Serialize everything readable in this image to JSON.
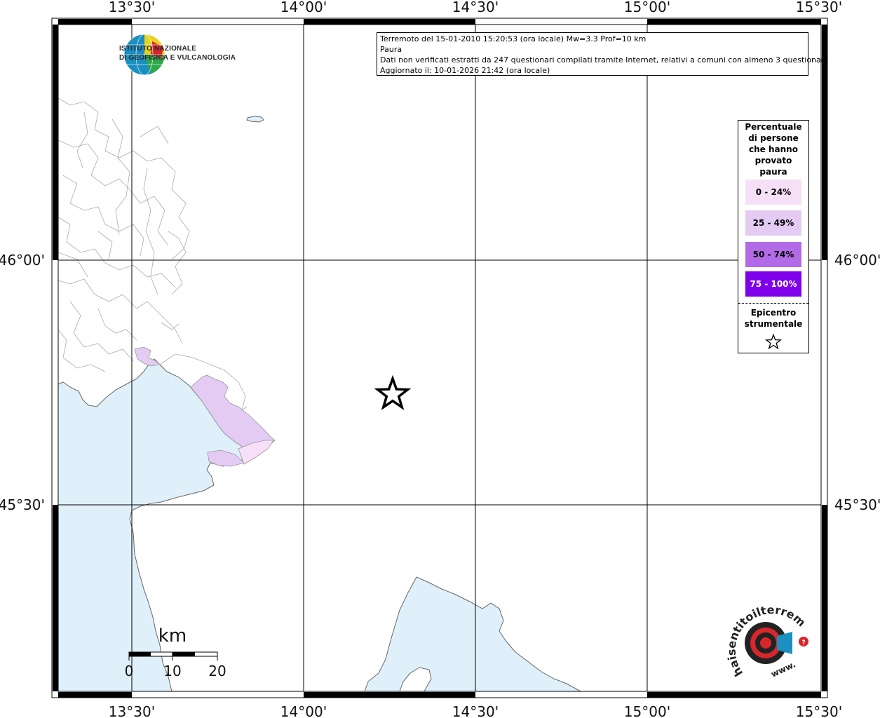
{
  "map": {
    "lon_ticks_top": [
      "13°30'",
      "14°00'",
      "14°30'",
      "15°00'",
      "15°30'"
    ],
    "lon_ticks_bottom": [
      "13°30'",
      "14°00'",
      "14°30'",
      "15°00'",
      "15°30'"
    ],
    "lat_ticks_left": [
      "46°00'",
      "45°30'"
    ],
    "lat_ticks_right": [
      "46°00'",
      "45°30'"
    ]
  },
  "info": {
    "line1": "Terremoto del 15-01-2010 15:20:53 (ora locale) Mw=3.3 Prof=10 km",
    "line2": "Paura",
    "line3": "Dati non verificati estratti da 247 questionari compilati tramite Internet, relativi a comuni con almeno 3 questionari.",
    "line4": "Aggiornato il: 10-01-2026 21:42 (ora locale)"
  },
  "legend": {
    "title": "Percentuale di persone che hanno provato paura",
    "items": [
      {
        "label": "0 - 24%",
        "color": "#f7e0f7"
      },
      {
        "label": "25 - 49%",
        "color": "#e4cbf4"
      },
      {
        "label": "50 - 74%",
        "color": "#b36ae6"
      },
      {
        "label": "75 - 100%",
        "color": "#7f00ea"
      }
    ],
    "epicenter_title": "Epicentro strumentale",
    "epicenter_icon": "star-outline-icon"
  },
  "scale": {
    "unit": "km",
    "labels": [
      "0",
      "10",
      "20"
    ]
  },
  "logos": {
    "ingv_line1": "ISTITUTO NAZIONALE",
    "ingv_line2": "DI GEOFISICA E VULCANOLOGIA",
    "hst_text": "haisentitoilterremoto.it",
    "hst_www": "www."
  },
  "colors": {
    "sea": "#dff0fb",
    "fear_25_49": "#e4cbf4",
    "fear_0_24": "#f7e0f7"
  }
}
